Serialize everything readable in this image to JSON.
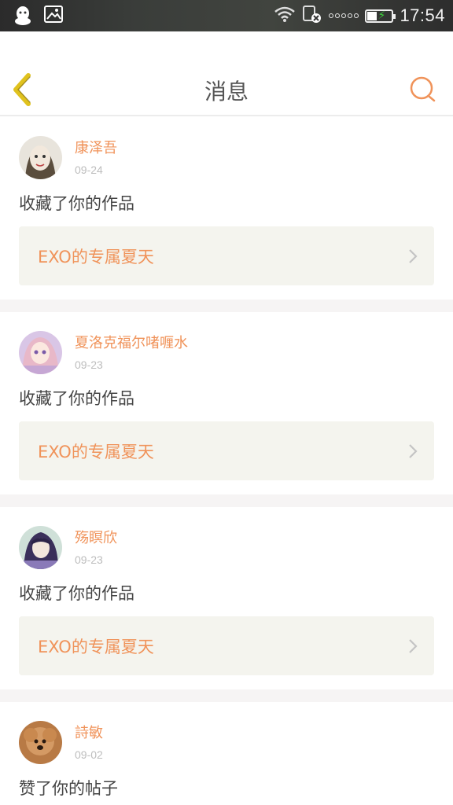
{
  "status_bar": {
    "time": "17:54"
  },
  "header": {
    "title": "消息"
  },
  "messages": [
    {
      "username": "康泽吾",
      "date": "09-24",
      "action": "收藏了你的作品",
      "work_title": "EXO的专属夏天"
    },
    {
      "username": "夏洛克福尔啫喱水",
      "date": "09-23",
      "action": "收藏了你的作品",
      "work_title": "EXO的专属夏天"
    },
    {
      "username": "殇瞑欣",
      "date": "09-23",
      "action": "收藏了你的作品",
      "work_title": "EXO的专属夏天"
    },
    {
      "username": "詩敏",
      "date": "09-02",
      "action": "赞了你的帖子"
    }
  ],
  "colors": {
    "accent": "#f0935a",
    "back_icon": "#e0c21e",
    "card_bg": "#f4f4ee"
  }
}
